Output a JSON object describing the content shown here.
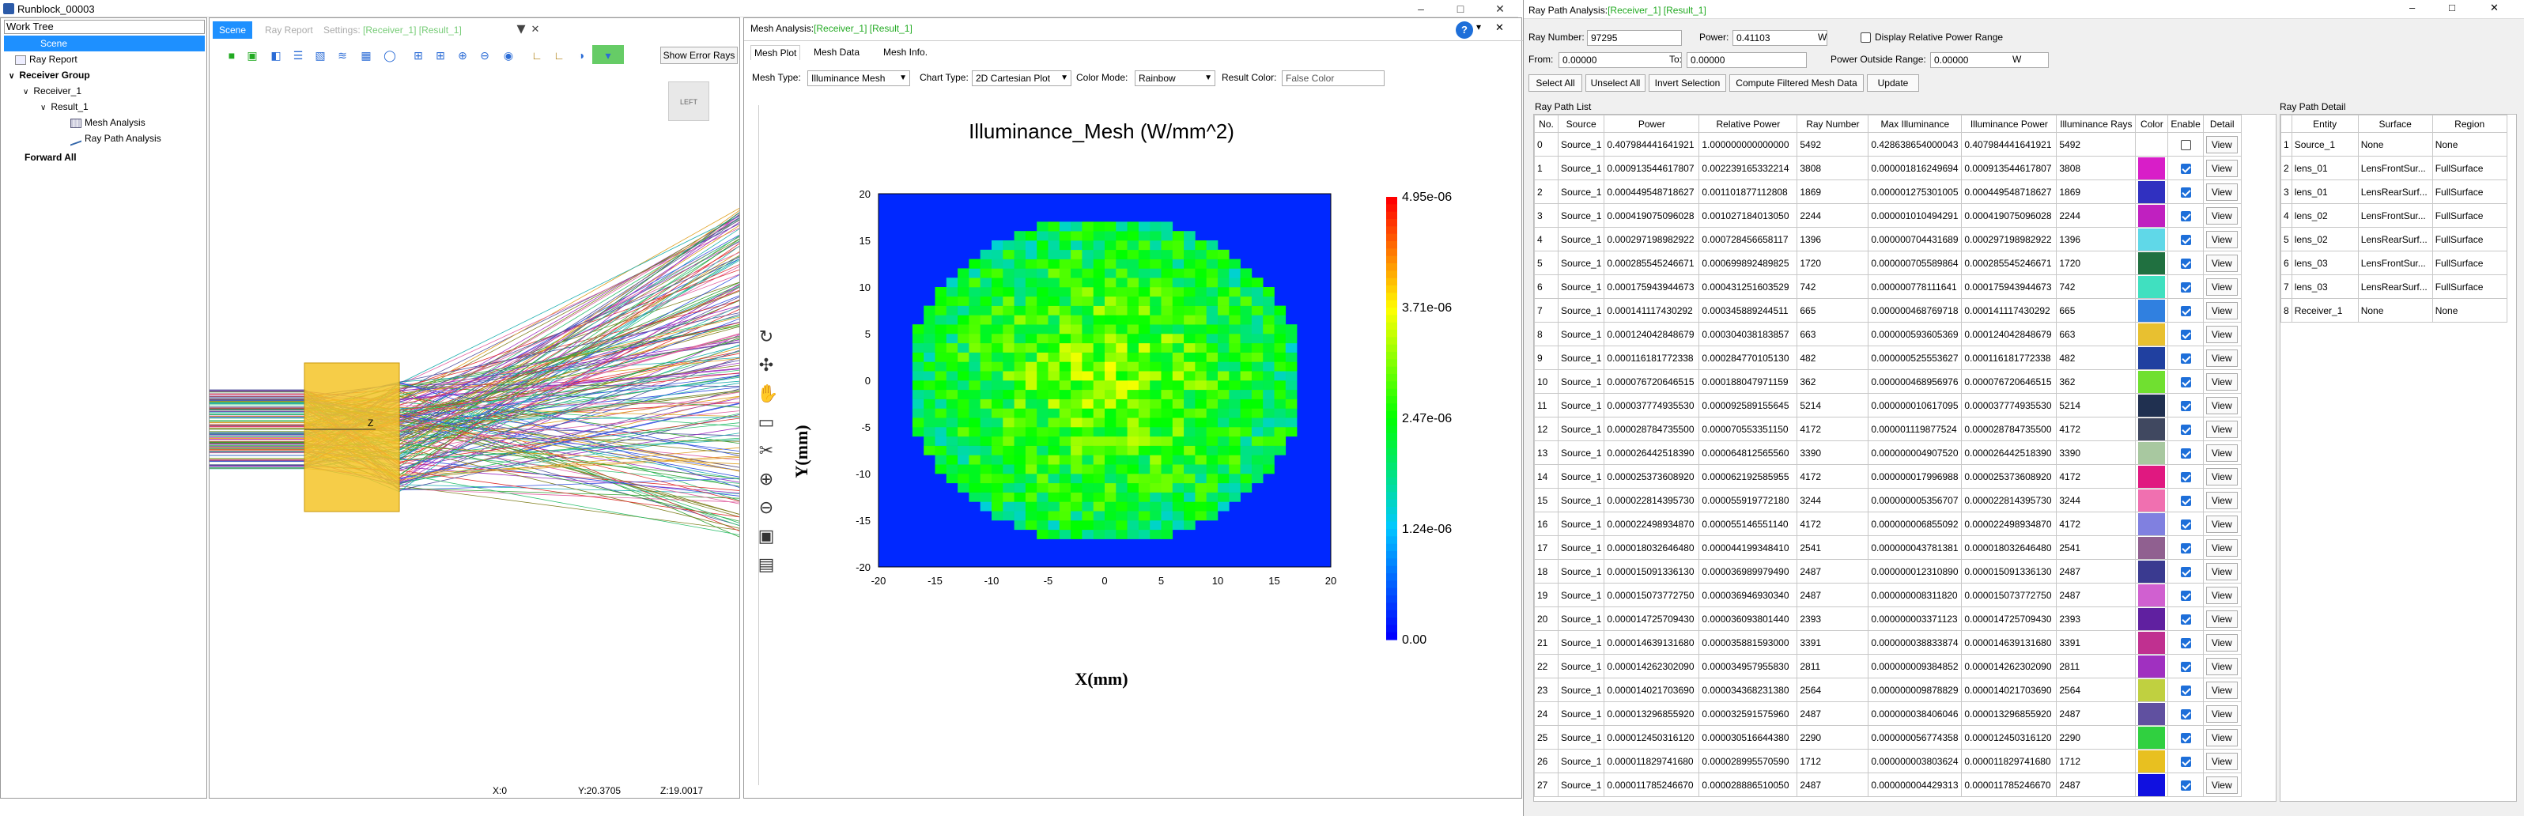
{
  "window": {
    "title": "Runblock_00003"
  },
  "work_tree": {
    "header": "Work Tree",
    "items": [
      {
        "label": "Scene",
        "selected": true
      },
      {
        "label": "Ray Report"
      },
      {
        "label": "Receiver Group"
      },
      {
        "label": "Receiver_1"
      },
      {
        "label": "Result_1"
      },
      {
        "label": "Mesh Analysis"
      },
      {
        "label": "Ray Path Analysis"
      },
      {
        "label": "Forward All"
      }
    ]
  },
  "scene": {
    "tabs": [
      {
        "label": "Scene"
      },
      {
        "label": "Ray Report"
      },
      {
        "label": "Settings:",
        "suffix": "[Receiver_1] [Result_1]"
      }
    ],
    "show_error_rays": "Show Error Rays",
    "cube_label": "LEFT",
    "status": {
      "x": "X:0",
      "y": "Y:20.3705",
      "z": "Z:19.0017"
    }
  },
  "mesh": {
    "title_prefix": "Mesh Analysis:",
    "title_suffix": "[Receiver_1] [Result_1]",
    "tabs": [
      "Mesh Plot",
      "Mesh Data",
      "Mesh Info."
    ],
    "mesh_type_label": "Mesh Type:",
    "mesh_type_value": "Illuminance Mesh",
    "chart_type_label": "Chart Type:",
    "chart_type_value": "2D Cartesian Plot",
    "color_mode_label": "Color Mode:",
    "color_mode_value": "Rainbow",
    "result_color_label": "Result Color:",
    "result_color_value": "False Color"
  },
  "chart_data": {
    "type": "heatmap",
    "title": "Illuminance_Mesh (W/mm^2)",
    "xlabel": "X(mm)",
    "ylabel": "Y(mm)",
    "xlim": [
      -20,
      20
    ],
    "ylim": [
      -20,
      20
    ],
    "x_ticks": [
      "-20",
      "-15",
      "-10",
      "-5",
      "0",
      "5",
      "10",
      "15",
      "20"
    ],
    "y_ticks": [
      "20",
      "15",
      "10",
      "5",
      "0",
      "-5",
      "-10",
      "-15",
      "-20"
    ],
    "colorbar_ticks": [
      "4.95e-06",
      "3.71e-06",
      "2.47e-06",
      "1.24e-06",
      "0.00"
    ],
    "colormap": "rainbow",
    "max_value": 4.95e-06,
    "min_value": 0.0
  },
  "raypath": {
    "title_prefix": "Ray Path Analysis:",
    "title_suffix": "[Receiver_1] [Result_1]",
    "ray_number_label": "Ray Number:",
    "ray_number_value": "97295",
    "power_label": "Power:",
    "power_value": "0.41103",
    "power_unit": "W",
    "display_relative_label": "Display Relative Power Range",
    "from_label": "From:",
    "from_value": "0.00000",
    "to_label": "To:",
    "to_value": "0.00000",
    "outside_label": "Power Outside Range:",
    "outside_value": "0.00000",
    "outside_unit": "W",
    "buttons": [
      "Select All",
      "Unselect All",
      "Invert Selection",
      "Compute Filtered Mesh Data",
      "Update"
    ],
    "list_label": "Ray Path List",
    "detail_label": "Ray Path Detail",
    "columns": [
      "No.",
      "Source",
      "Power",
      "Relative Power",
      "Ray Number",
      "Max Illuminance",
      "Illuminance Power",
      "Illuminance Rays",
      "Color",
      "Enable",
      "Detail"
    ],
    "view_label": "View",
    "rows": [
      [
        "0",
        "Source_1",
        "0.407984441641921",
        "1.000000000000000",
        "5492",
        "0.428638654000043",
        "0.407984441641921",
        "5492",
        "",
        false
      ],
      [
        "1",
        "Source_1",
        "0.000913544617807",
        "0.002239165332214",
        "3808",
        "0.000001816249694",
        "0.000913544617807",
        "3808",
        "#d81ec8",
        true
      ],
      [
        "2",
        "Source_1",
        "0.000449548718627",
        "0.001101877112808",
        "1869",
        "0.000001275301005",
        "0.000449548718627",
        "1869",
        "#3030c0",
        true
      ],
      [
        "3",
        "Source_1",
        "0.000419075096028",
        "0.001027184013050",
        "2244",
        "0.000001010494291",
        "0.000419075096028",
        "2244",
        "#c020c0",
        true
      ],
      [
        "4",
        "Source_1",
        "0.000297198982922",
        "0.000728456658117",
        "1396",
        "0.000000704431689",
        "0.000297198982922",
        "1396",
        "#60d8e8",
        true
      ],
      [
        "5",
        "Source_1",
        "0.000285545246671",
        "0.000699892489825",
        "1720",
        "0.000000705589864",
        "0.000285545246671",
        "1720",
        "#207040",
        true
      ],
      [
        "6",
        "Source_1",
        "0.000175943944673",
        "0.000431251603529",
        "742",
        "0.000000778111641",
        "0.000175943944673",
        "742",
        "#40e0c0",
        true
      ],
      [
        "7",
        "Source_1",
        "0.000141117430292",
        "0.000345889244511",
        "665",
        "0.000000468769718",
        "0.000141117430292",
        "665",
        "#3080e0",
        true
      ],
      [
        "8",
        "Source_1",
        "0.000124042848679",
        "0.000304038183857",
        "663",
        "0.000000593605369",
        "0.000124042848679",
        "663",
        "#e8c030",
        true
      ],
      [
        "9",
        "Source_1",
        "0.000116181772338",
        "0.000284770105130",
        "482",
        "0.000000525553627",
        "0.000116181772338",
        "482",
        "#2040a0",
        true
      ],
      [
        "10",
        "Source_1",
        "0.000076720646515",
        "0.000188047971159",
        "362",
        "0.000000468956976",
        "0.000076720646515",
        "362",
        "#70e030",
        true
      ],
      [
        "11",
        "Source_1",
        "0.000037774935530",
        "0.000092589155645",
        "5214",
        "0.000000010617095",
        "0.000037774935530",
        "5214",
        "#203050",
        true
      ],
      [
        "12",
        "Source_1",
        "0.000028784735500",
        "0.000070553351150",
        "4172",
        "0.000001119877524",
        "0.000028784735500",
        "4172",
        "#404860",
        true
      ],
      [
        "13",
        "Source_1",
        "0.000026442518390",
        "0.000064812565560",
        "3390",
        "0.000000004907520",
        "0.000026442518390",
        "3390",
        "#a8c8a0",
        true
      ],
      [
        "14",
        "Source_1",
        "0.000025373608920",
        "0.000062192585955",
        "4172",
        "0.000000017996988",
        "0.000025373608920",
        "4172",
        "#e01880",
        true
      ],
      [
        "15",
        "Source_1",
        "0.000022814395730",
        "0.000055919772180",
        "3244",
        "0.000000005356707",
        "0.000022814395730",
        "3244",
        "#f070b0",
        true
      ],
      [
        "16",
        "Source_1",
        "0.000022498934870",
        "0.000055146551140",
        "4172",
        "0.000000006855092",
        "0.000022498934870",
        "4172",
        "#8080e0",
        true
      ],
      [
        "17",
        "Source_1",
        "0.000018032646480",
        "0.000044199348410",
        "2541",
        "0.000000043781381",
        "0.000018032646480",
        "2541",
        "#906090",
        true
      ],
      [
        "18",
        "Source_1",
        "0.000015091336130",
        "0.000036989979490",
        "2487",
        "0.000000012310890",
        "0.000015091336130",
        "2487",
        "#3a3a90",
        true
      ],
      [
        "19",
        "Source_1",
        "0.000015073772750",
        "0.000036946930340",
        "2487",
        "0.000000008311820",
        "0.000015073772750",
        "2487",
        "#d060d0",
        true
      ],
      [
        "20",
        "Source_1",
        "0.000014725709430",
        "0.000036093801440",
        "2393",
        "0.000000003371123",
        "0.000014725709430",
        "2393",
        "#6020a0",
        true
      ],
      [
        "21",
        "Source_1",
        "0.000014639131680",
        "0.000035881593000",
        "3391",
        "0.000000038833874",
        "0.000014639131680",
        "3391",
        "#c03090",
        true
      ],
      [
        "22",
        "Source_1",
        "0.000014262302090",
        "0.000034957955830",
        "2811",
        "0.000000009384852",
        "0.000014262302090",
        "2811",
        "#a030c0",
        true
      ],
      [
        "23",
        "Source_1",
        "0.000014021703690",
        "0.000034368231380",
        "2564",
        "0.000000009878829",
        "0.000014021703690",
        "2564",
        "#c0d040",
        true
      ],
      [
        "24",
        "Source_1",
        "0.000013296855920",
        "0.000032591575960",
        "2487",
        "0.000000038406046",
        "0.000013296855920",
        "2487",
        "#6050a0",
        true
      ],
      [
        "25",
        "Source_1",
        "0.000012450316120",
        "0.000030516644380",
        "2290",
        "0.000000056774358",
        "0.000012450316120",
        "2290",
        "#30d040",
        true
      ],
      [
        "26",
        "Source_1",
        "0.000011829741680",
        "0.000028995570590",
        "1712",
        "0.000000003803624",
        "0.000011829741680",
        "1712",
        "#e8c020",
        true
      ],
      [
        "27",
        "Source_1",
        "0.000011785246670",
        "0.000028886510050",
        "2487",
        "0.000000004429313",
        "0.000011785246670",
        "2487",
        "#1010e0",
        true
      ]
    ],
    "detail_columns": [
      "",
      "Entity",
      "Surface",
      "Region"
    ],
    "detail_rows": [
      [
        "1",
        "Source_1",
        "None",
        "None"
      ],
      [
        "2",
        "lens_01",
        "LensFrontSur...",
        "FullSurface"
      ],
      [
        "3",
        "lens_01",
        "LensRearSurf...",
        "FullSurface"
      ],
      [
        "4",
        "lens_02",
        "LensFrontSur...",
        "FullSurface"
      ],
      [
        "5",
        "lens_02",
        "LensRearSurf...",
        "FullSurface"
      ],
      [
        "6",
        "lens_03",
        "LensFrontSur...",
        "FullSurface"
      ],
      [
        "7",
        "lens_03",
        "LensRearSurf...",
        "FullSurface"
      ],
      [
        "8",
        "Receiver_1",
        "None",
        "None"
      ]
    ]
  }
}
